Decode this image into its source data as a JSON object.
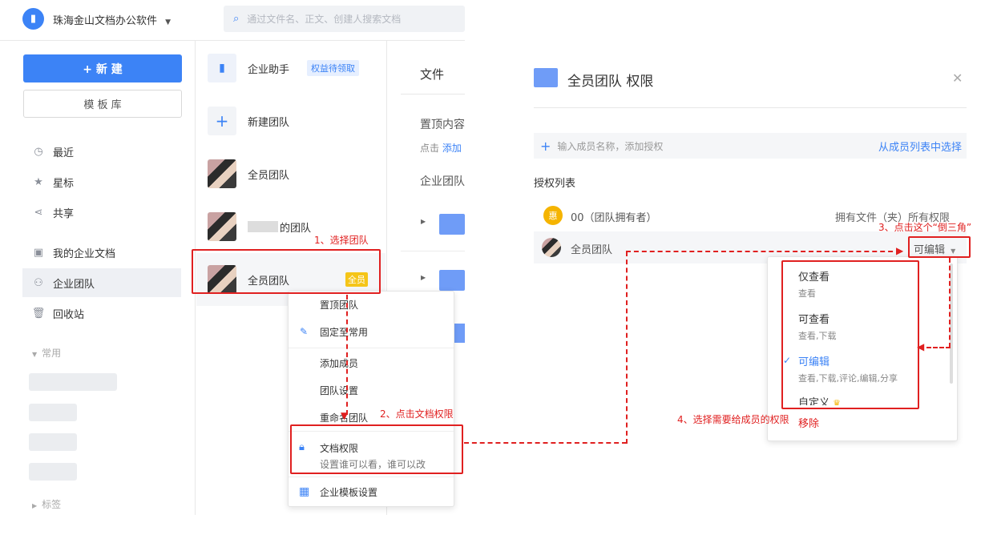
{
  "topbar": {
    "org_name": "珠海金山文档办公软件",
    "search_placeholder": "通过文件名、正文、创建人搜索文档"
  },
  "sidebar": {
    "new_button": "+ 新 建",
    "template_button": "模 板 库",
    "items": [
      {
        "label": "最近",
        "icon": "clock-icon"
      },
      {
        "label": "星标",
        "icon": "star-icon"
      },
      {
        "label": "共享",
        "icon": "share-icon"
      },
      {
        "label": "我的企业文档",
        "icon": "person-doc-icon"
      },
      {
        "label": "企业团队",
        "icon": "team-icon"
      },
      {
        "label": "回收站",
        "icon": "trash-icon"
      }
    ],
    "common_label": "常用",
    "tags_label": "标签"
  },
  "teams": {
    "assistant": {
      "name": "企业助手",
      "badge": "权益待领取"
    },
    "new_team": "新建团队",
    "team1": "全员团队",
    "team2": "的团队",
    "team3": {
      "name": "全员团队",
      "badge": "全员"
    }
  },
  "files": {
    "tab": "文件",
    "pinned": "置顶内容",
    "hint_prefix": "点击",
    "hint_link": "添加",
    "section": "企业团队"
  },
  "context_menu": {
    "items": [
      "置顶团队",
      "固定至常用",
      "添加成员",
      "团队设置",
      "重命名团队"
    ],
    "perm_title": "文档权限",
    "perm_desc": "设置谁可以看，谁可以改",
    "template": "企业模板设置"
  },
  "permission_dialog": {
    "title": "全员团队 权限",
    "add_placeholder": "输入成员名称，添加授权",
    "select_link": "从成员列表中选择",
    "list_label": "授权列表",
    "owner_avatar": "惠",
    "owner_name": "00（团队拥有者）",
    "owner_perm": "拥有文件（夹）所有权限",
    "member_name": "全员团队",
    "member_perm": "可编辑",
    "options": [
      {
        "title": "仅查看",
        "desc": "查看"
      },
      {
        "title": "可查看",
        "desc": "查看,下载"
      },
      {
        "title": "可编辑",
        "desc": "查看,下载,评论,编辑,分享"
      },
      {
        "title": "自定义",
        "desc": ""
      }
    ],
    "remove": "移除"
  },
  "annotations": {
    "step1": "1、选择团队",
    "step2": "2、点击文档权限",
    "step3": "3、点击这个“倒三角”",
    "step4": "4、选择需要给成员的权限"
  },
  "colors": {
    "primary": "#3c83f6",
    "red": "#e02020",
    "badge_yellow": "#f5c518"
  }
}
